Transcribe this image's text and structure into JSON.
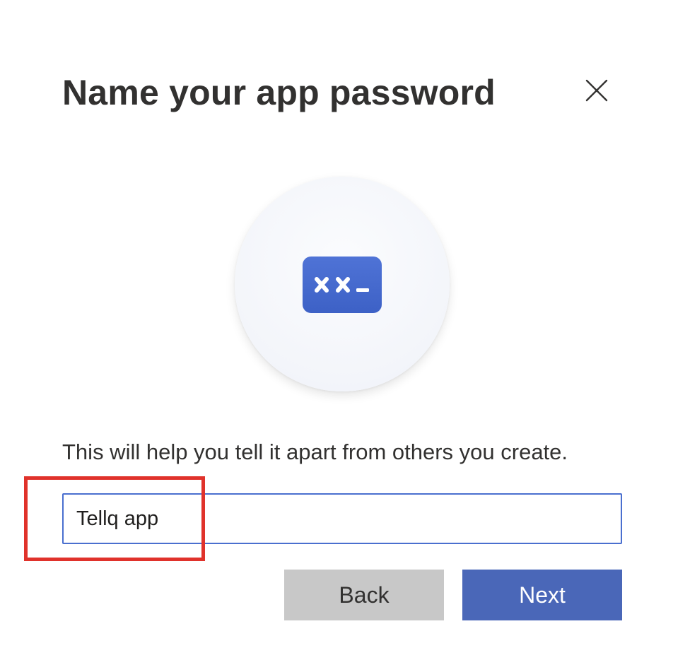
{
  "dialog": {
    "title": "Name your app password",
    "close_icon": "close-icon"
  },
  "illustration": {
    "icon": "password-key-icon",
    "accent_color": "#4466cc"
  },
  "description": "This will help you tell it apart from others you create.",
  "name_input": {
    "value": "Tellq app"
  },
  "buttons": {
    "back_label": "Back",
    "next_label": "Next"
  },
  "colors": {
    "primary": "#4a67b8",
    "secondary": "#c8c8c8",
    "highlight": "#e0322b"
  }
}
